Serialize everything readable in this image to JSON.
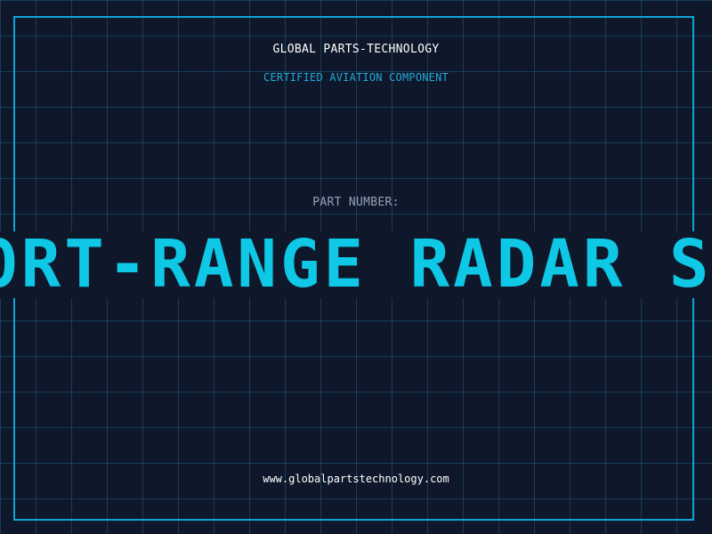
{
  "header": {
    "title": "GLOBAL PARTS-TECHNOLOGY",
    "subtitle": "CERTIFIED AVIATION COMPONENT"
  },
  "part": {
    "label": "PART NUMBER:",
    "name": "SHORT-RANGE RADAR SYSTEM"
  },
  "footer": {
    "url": "www.globalpartstechnology.com"
  },
  "colors": {
    "background": "#0f172a",
    "grid": "#38bdf8",
    "frame": "#0ea5d6",
    "accent": "#0ec8e6",
    "subtitle": "#22a9d8",
    "label": "#94a3b8",
    "text": "#ffffff"
  }
}
